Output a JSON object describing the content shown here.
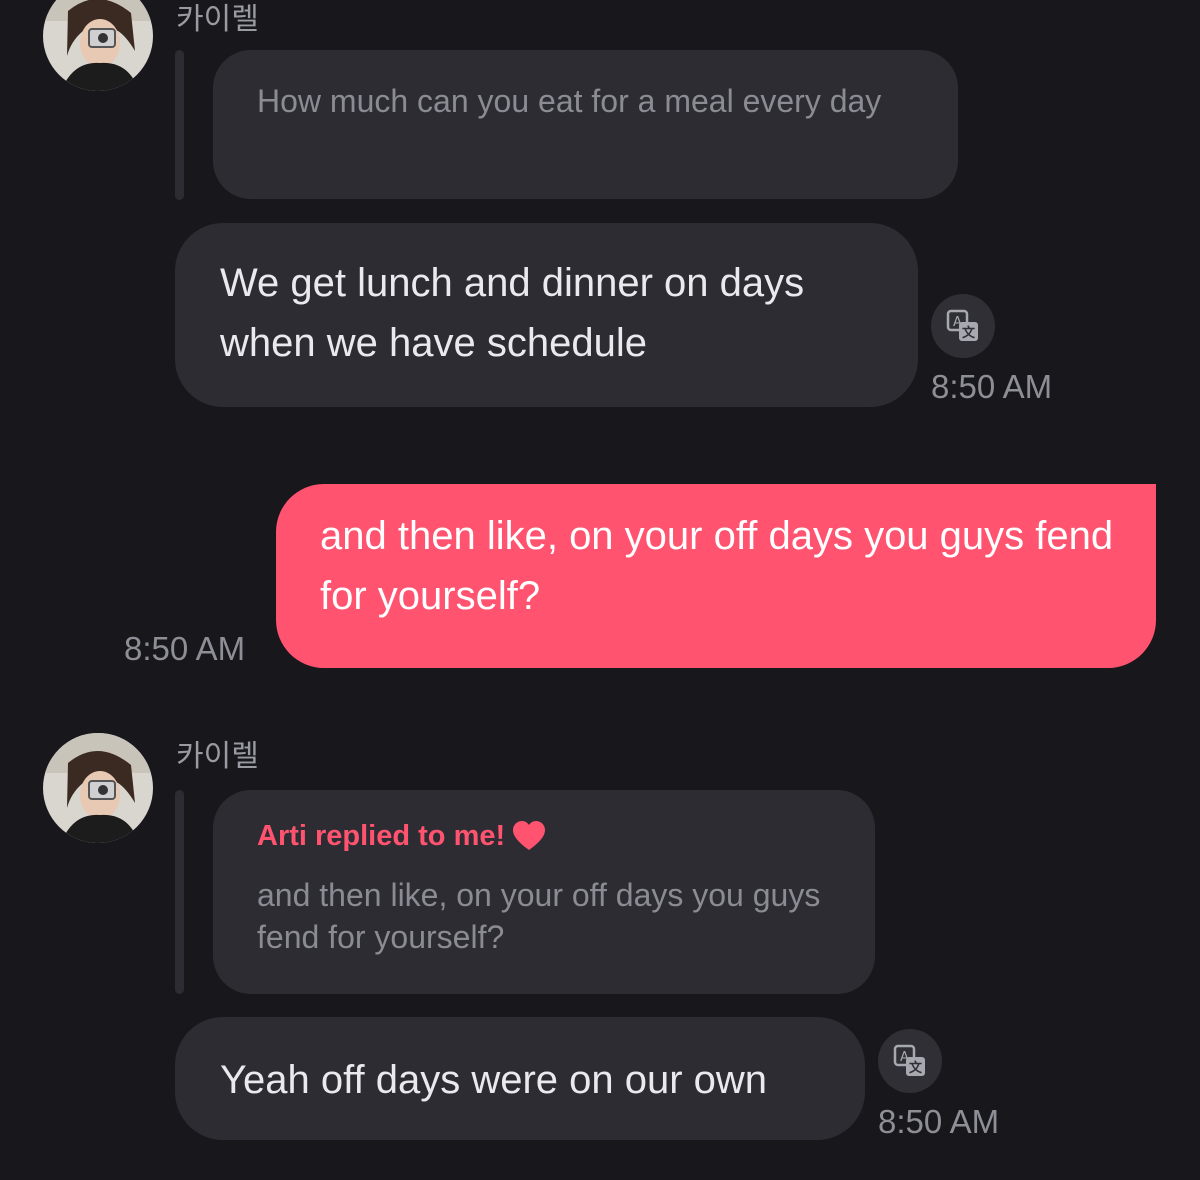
{
  "conversation": {
    "block1": {
      "sender": "카이렐",
      "quote_text": "How much can you eat for a meal every day",
      "message": "We get lunch and dinner on days when we have schedule",
      "time": "8:50 AM",
      "translate_icon": "translate-icon"
    },
    "outgoing": {
      "message": "and then like, on your off days you guys fend for yourself?",
      "time": "8:50 AM",
      "bubble_color": "#ff5370"
    },
    "block2": {
      "sender": "카이렐",
      "reply_title": "Arti replied to me!",
      "reply_icon": "heart-icon",
      "quote_text": "and then like, on your off days you guys fend for yourself?",
      "message": "Yeah off days were on our own",
      "time": "8:50 AM",
      "translate_icon": "translate-icon"
    }
  },
  "colors": {
    "background": "#17171c",
    "incoming_bubble": "#2c2c32",
    "accent": "#ff5370"
  }
}
